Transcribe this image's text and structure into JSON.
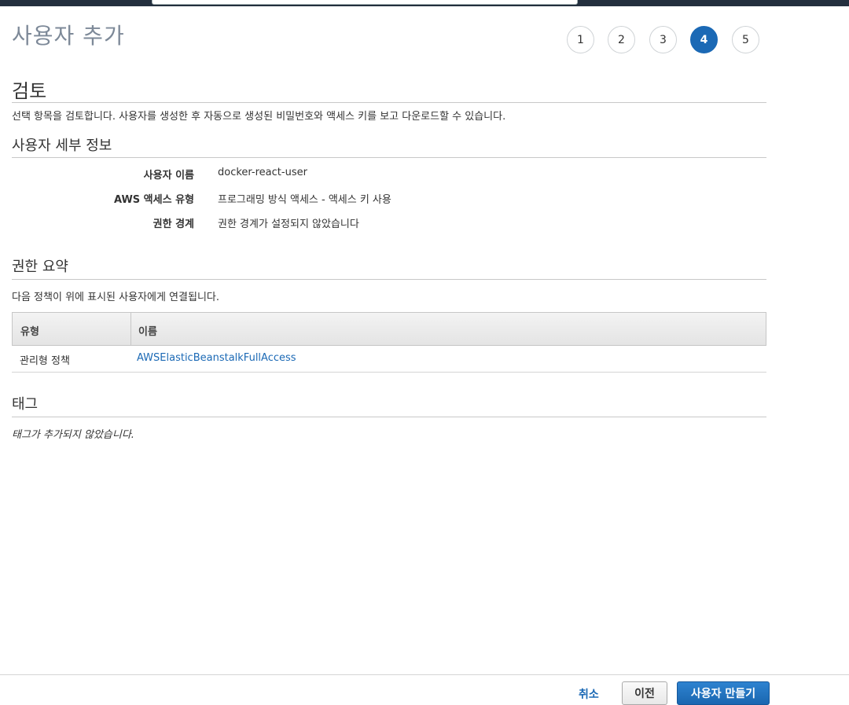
{
  "page": {
    "title": "사용자 추가"
  },
  "steps": [
    {
      "label": "1",
      "active": false
    },
    {
      "label": "2",
      "active": false
    },
    {
      "label": "3",
      "active": false
    },
    {
      "label": "4",
      "active": true
    },
    {
      "label": "5",
      "active": false
    }
  ],
  "review": {
    "title": "검토",
    "description": "선택 항목을 검토합니다. 사용자를 생성한 후 자동으로 생성된 비밀번호와 액세스 키를 보고 다운로드할 수 있습니다."
  },
  "user_details": {
    "title": "사용자 세부 정보",
    "fields": [
      {
        "label": "사용자 이름",
        "value": "docker-react-user"
      },
      {
        "label": "AWS 액세스 유형",
        "value": "프로그래밍 방식 액세스 - 액세스 키 사용"
      },
      {
        "label": "권한 경계",
        "value": "권한 경계가 설정되지 않았습니다"
      }
    ]
  },
  "permissions": {
    "title": "권한 요약",
    "description": "다음 정책이 위에 표시된 사용자에게 연결됩니다.",
    "columns": [
      "유형",
      "이름"
    ],
    "rows": [
      {
        "type": "관리형 정책",
        "name": "AWSElasticBeanstalkFullAccess"
      }
    ]
  },
  "tags": {
    "title": "태그",
    "empty_text": "태그가 추가되지 않았습니다."
  },
  "footer": {
    "cancel_label": "취소",
    "prev_label": "이전",
    "create_label": "사용자 만들기"
  },
  "colors": {
    "accent": "#1b69b5",
    "header_bg": "#232f3e"
  }
}
